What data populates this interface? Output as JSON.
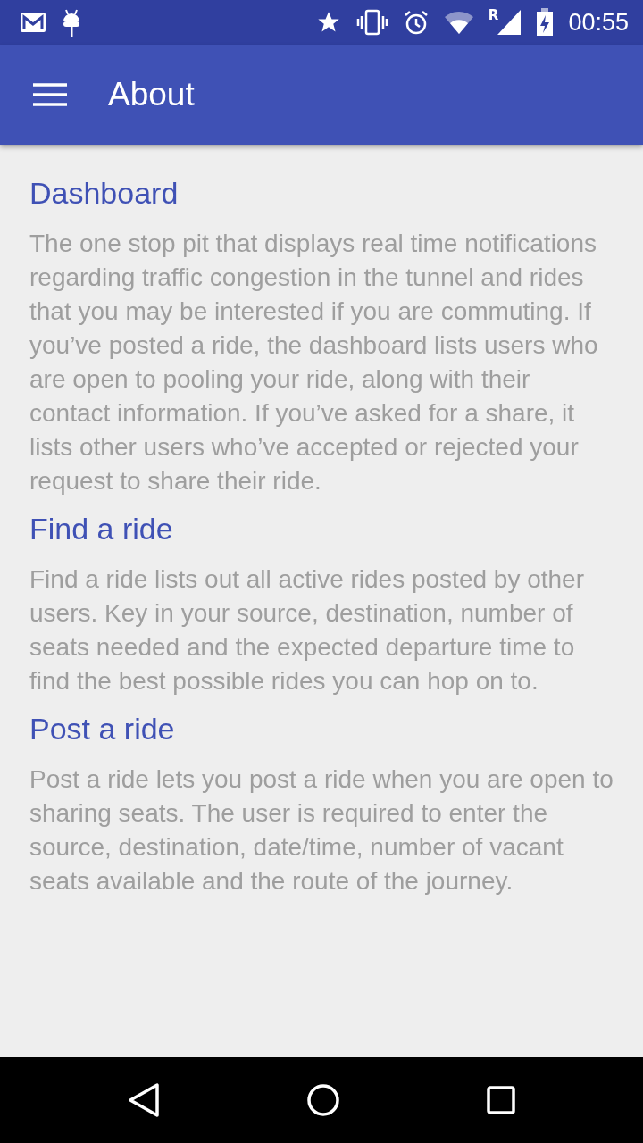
{
  "status_bar": {
    "roaming": "R",
    "time": "00:55"
  },
  "app_bar": {
    "title": "About"
  },
  "sections": [
    {
      "heading": "Dashboard",
      "body": "The one stop pit that displays real time notifications regarding traffic congestion in the tunnel and rides that you may be interested if you are commuting. If you’ve posted a ride, the dashboard lists users who are open to pooling your ride, along with their contact information. If you’ve asked for a share, it lists other users who’ve accepted or rejected your request to share their ride."
    },
    {
      "heading": "Find a ride",
      "body": "Find a ride lists out all active rides posted by other users. Key in your source, destination, number of seats needed and the expected departure time to find the best possible rides you can hop on to."
    },
    {
      "heading": "Post a ride",
      "body": "Post a ride lets you post a ride when you are open to sharing seats. The user is required to enter the source, destination, date/time, number of vacant seats available and the route of the journey."
    }
  ]
}
